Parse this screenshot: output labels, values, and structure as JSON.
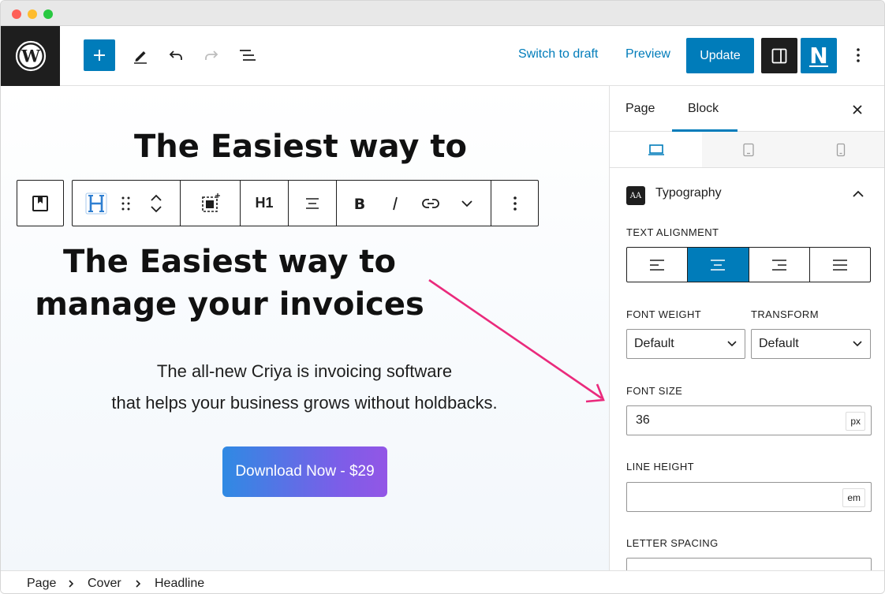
{
  "header": {
    "switch_to_draft": "Switch to draft",
    "preview": "Preview",
    "update": "Update",
    "n_logo_letter": "N"
  },
  "canvas": {
    "top_headline": "The Easiest way to",
    "top_headline_cut": "manage your invoices",
    "headline_line1": "The Easiest way to",
    "headline_line2": "manage your invoices",
    "subtext_line1": "The all-new Criya is invoicing software",
    "subtext_line2": "that helps your business grows without holdbacks.",
    "cta_label": "Download Now - $29",
    "cta_gradient": [
      "#2f8ae3",
      "#9356e6"
    ],
    "annotation_arrow_color": "#ea2a7c"
  },
  "block_toolbar": {
    "heading_level": "H1"
  },
  "sidebar": {
    "tabs": [
      {
        "label": "Page",
        "active": false
      },
      {
        "label": "Block",
        "active": true
      }
    ],
    "devices": [
      {
        "name": "desktop-icon",
        "active": true
      },
      {
        "name": "tablet-icon",
        "active": false
      },
      {
        "name": "mobile-icon",
        "active": false
      }
    ],
    "panel_title": "Typography",
    "panel_icon_text": "AA",
    "text_alignment_label": "TEXT ALIGNMENT",
    "text_alignment_selected": "center",
    "font_weight_label": "FONT WEIGHT",
    "font_weight_value": "Default",
    "transform_label": "TRANSFORM",
    "transform_value": "Default",
    "font_size_label": "FONT SIZE",
    "font_size_value": "36",
    "font_size_unit": "px",
    "line_height_label": "LINE HEIGHT",
    "line_height_value": "",
    "line_height_unit": "em",
    "letter_spacing_label": "LETTER SPACING",
    "accent_color": "#007cba"
  },
  "breadcrumb": {
    "items": [
      "Page",
      "Cover",
      "Headline"
    ]
  }
}
